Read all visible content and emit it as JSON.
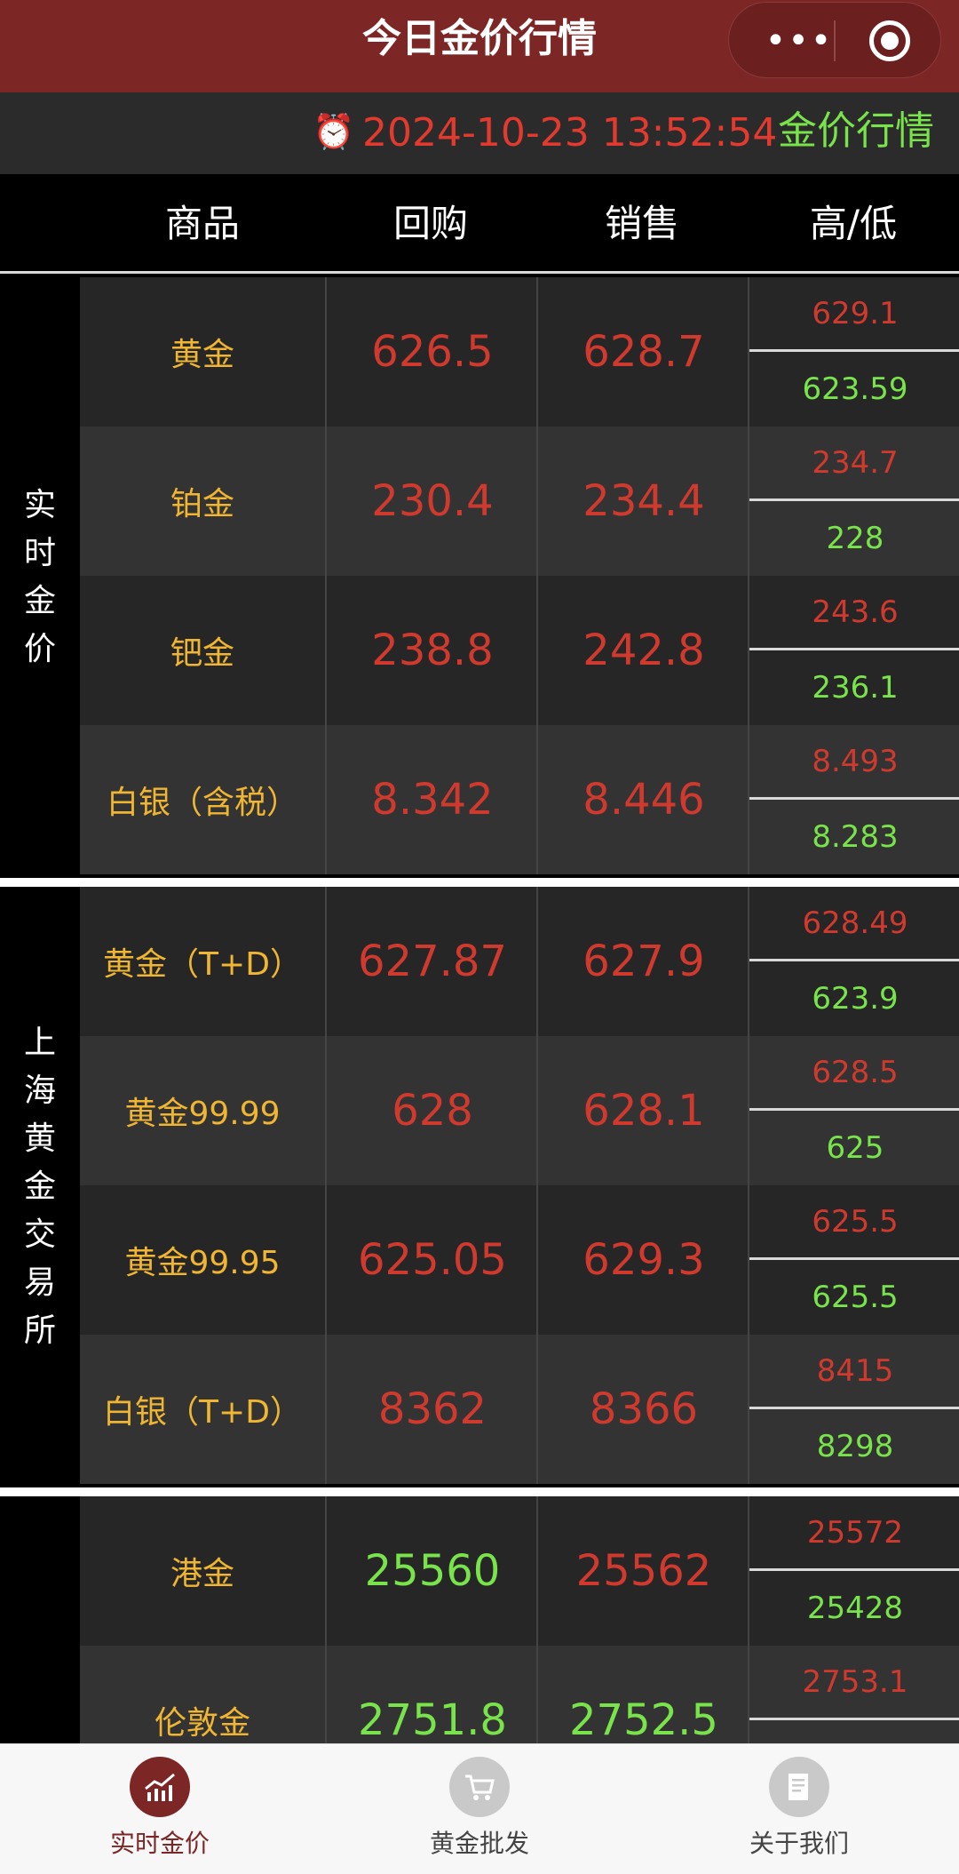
{
  "title": "今日金价行情",
  "capsule": {
    "more_glyph": "•••"
  },
  "timebar": {
    "datetime": "2024-10-23 13:52:54",
    "label": "金价行情"
  },
  "header": {
    "col_name": "商品",
    "col_buy": "回购",
    "col_sell": "销售",
    "col_hl": "高/低"
  },
  "sections": [
    {
      "label_chars": [
        "实",
        "时",
        "金",
        "价"
      ],
      "rows": [
        {
          "name": "黄金",
          "buy": "626.5",
          "sell": "628.7",
          "high": "629.1",
          "low": "623.59"
        },
        {
          "name": "铂金",
          "buy": "230.4",
          "sell": "234.4",
          "high": "234.7",
          "low": "228"
        },
        {
          "name": "钯金",
          "buy": "238.8",
          "sell": "242.8",
          "high": "243.6",
          "low": "236.1"
        },
        {
          "name": "白银（含税）",
          "buy": "8.342",
          "sell": "8.446",
          "high": "8.493",
          "low": "8.283"
        }
      ]
    },
    {
      "label_chars": [
        "上",
        "海",
        "黄",
        "金",
        "交",
        "易",
        "所"
      ],
      "rows": [
        {
          "name": "黄金（T+D）",
          "buy": "627.87",
          "sell": "627.9",
          "high": "628.49",
          "low": "623.9"
        },
        {
          "name": "黄金99.99",
          "buy": "628",
          "sell": "628.1",
          "high": "628.5",
          "low": "625"
        },
        {
          "name": "黄金99.95",
          "buy": "625.05",
          "sell": "629.3",
          "high": "625.5",
          "low": "625.5"
        },
        {
          "name": "白银（T+D）",
          "buy": "8362",
          "sell": "8366",
          "high": "8415",
          "low": "8298"
        }
      ]
    },
    {
      "label_chars": [],
      "rows": [
        {
          "name": "港金",
          "buy": "25560",
          "sell": "25562",
          "high": "25572",
          "low": "25428",
          "buy_color": "green",
          "sell_color": "red"
        },
        {
          "name": "伦敦金",
          "buy": "2751.8",
          "sell": "2752.5",
          "high": "2753.1",
          "low": "",
          "buy_color": "green",
          "sell_color": "green"
        }
      ]
    }
  ],
  "colors": {
    "brand": "#7d2626",
    "up": "#d03a2e",
    "down": "#78e34a",
    "name": "#f0b632"
  },
  "tabs": [
    {
      "label": "实时金价",
      "icon": "chart-icon",
      "active": true
    },
    {
      "label": "黄金批发",
      "icon": "cart-icon",
      "active": false
    },
    {
      "label": "关于我们",
      "icon": "document-icon",
      "active": false
    }
  ]
}
